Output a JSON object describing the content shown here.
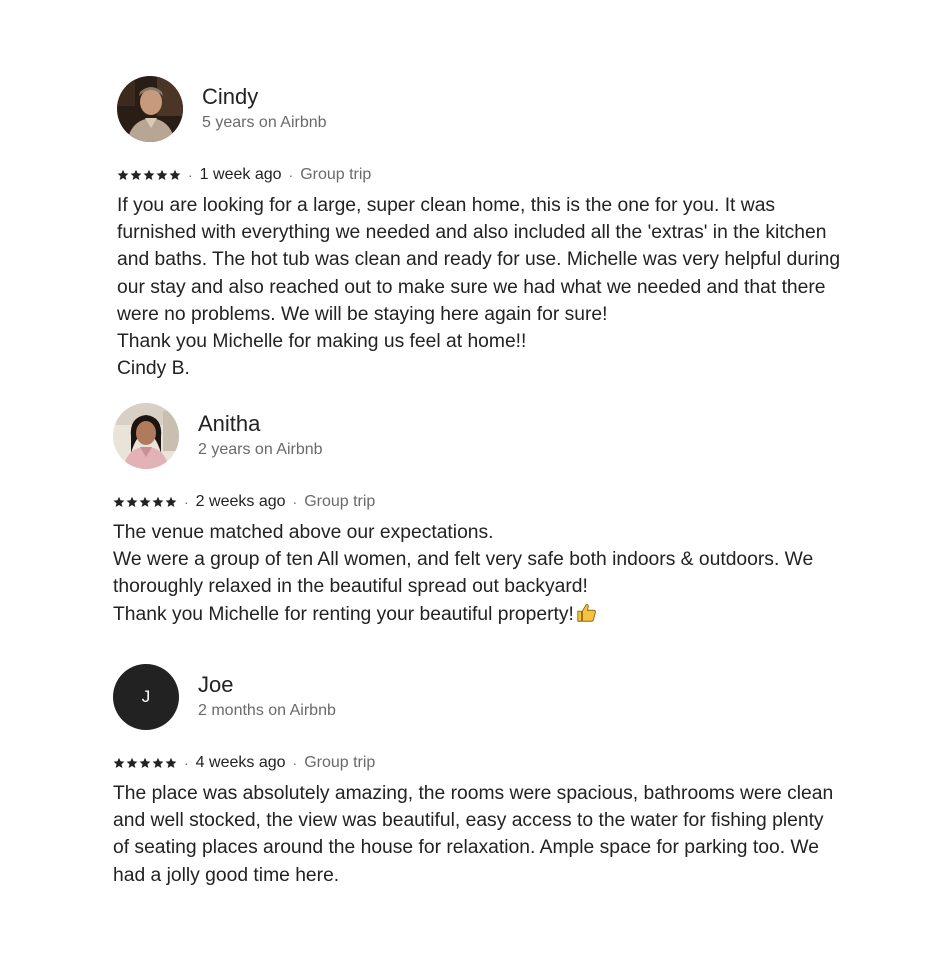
{
  "reviews": [
    {
      "name": "Cindy",
      "tenure": "5 years on Airbnb",
      "rating": 5,
      "date": "1 week ago",
      "trip_type": "Group trip",
      "avatar": "photo",
      "lines": [
        "If you are looking for a large, super clean home, this is the one for you. It was furnished with everything we needed and also included all the 'extras' in the kitchen and baths. The hot tub was clean and ready for use. Michelle was very helpful during our stay and also reached out to make sure we had what we needed and that there were no problems. We will be staying here again for sure!",
        "Thank you Michelle for making us feel at home!!",
        "Cindy B."
      ]
    },
    {
      "name": "Anitha",
      "tenure": "2 years on Airbnb",
      "rating": 5,
      "date": "2 weeks ago",
      "trip_type": "Group trip",
      "avatar": "photo",
      "lines": [
        "The venue matched above our expectations.",
        "We were a group of ten All women, and felt very safe both indoors & outdoors. We thoroughly relaxed in the beautiful spread out backyard!",
        "Thank you Michelle for renting your beautiful property!"
      ],
      "trailing_icon": "thumbs-up-icon"
    },
    {
      "name": "Joe",
      "tenure": "2 months on Airbnb",
      "rating": 5,
      "date": "4 weeks ago",
      "trip_type": "Group trip",
      "avatar": "initial",
      "avatar_initial": "J",
      "lines": [
        "The place was absolutely amazing, the rooms were spacious, bathrooms were clean and well stocked, the view was beautiful, easy access to the water for fishing plenty of seating places around the house for relaxation. Ample space for parking too. We had a jolly good time here."
      ]
    }
  ],
  "separator": "·",
  "colors": {
    "text_primary": "#222222",
    "text_secondary": "#6a6a6a",
    "avatar_initial_bg": "#222222"
  }
}
